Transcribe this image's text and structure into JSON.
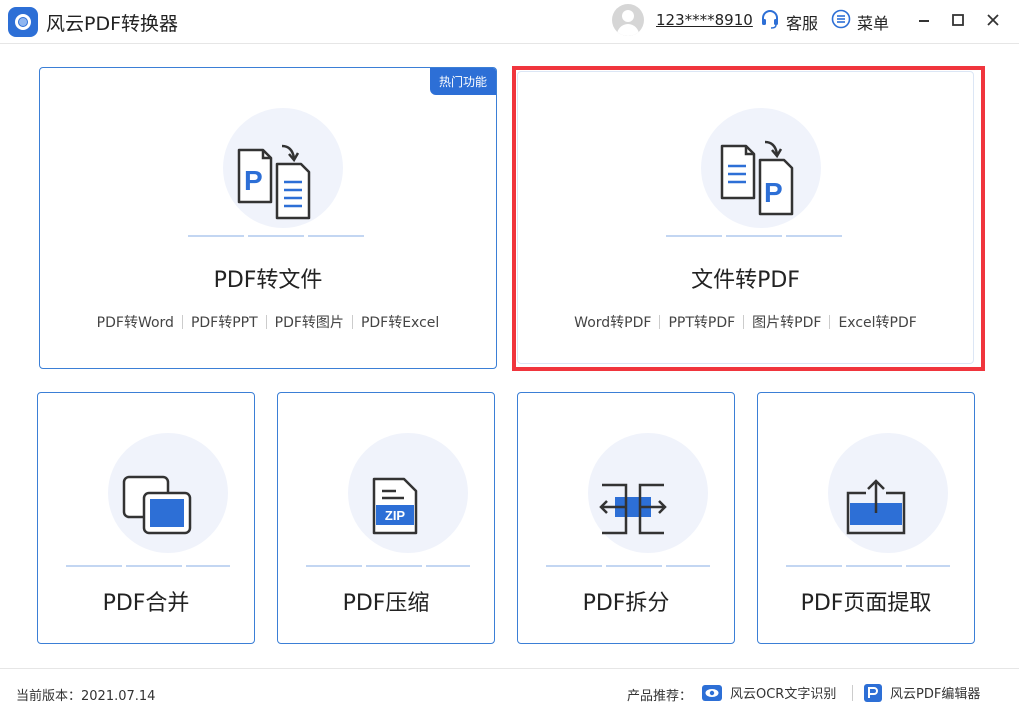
{
  "app": {
    "title": "风云PDF转换器"
  },
  "header": {
    "username": "123****8910",
    "service_label": "客服",
    "menu_label": "菜单"
  },
  "cards": {
    "pdf_to_file": {
      "title": "PDF转文件",
      "badge": "热门功能",
      "subs": [
        "PDF转Word",
        "PDF转PPT",
        "PDF转图片",
        "PDF转Excel"
      ]
    },
    "file_to_pdf": {
      "title": "文件转PDF",
      "subs": [
        "Word转PDF",
        "PPT转PDF",
        "图片转PDF",
        "Excel转PDF"
      ]
    },
    "merge": {
      "title": "PDF合并"
    },
    "compress": {
      "title": "PDF压缩",
      "icon_text": "ZIP"
    },
    "split": {
      "title": "PDF拆分"
    },
    "extract": {
      "title": "PDF页面提取"
    }
  },
  "footer": {
    "version": "当前版本：2021.07.14",
    "rec_label": "产品推荐：",
    "rec_items": [
      "风云OCR文字识别",
      "风云PDF编辑器"
    ]
  },
  "colors": {
    "accent": "#2d6fd6",
    "highlight": "#f0353d",
    "card_border": "#3b7fd6"
  }
}
